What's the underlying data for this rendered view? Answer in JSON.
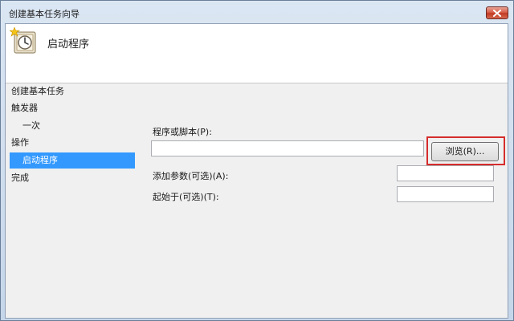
{
  "window": {
    "title": "创建基本任务向导"
  },
  "header": {
    "title": "启动程序",
    "icon": "clock-task-icon"
  },
  "nav": {
    "items": [
      {
        "label": "创建基本任务"
      },
      {
        "label": "触发器"
      },
      {
        "label": "一次"
      },
      {
        "label": "操作"
      },
      {
        "label": "启动程序"
      },
      {
        "label": "完成"
      }
    ],
    "selected": "启动程序"
  },
  "form": {
    "program_label": "程序或脚本(P):",
    "program_value": "",
    "browse_label": "浏览(R)...",
    "args_label": "添加参数(可选)(A):",
    "args_value": "",
    "start_in_label": "起始于(可选)(T):",
    "start_in_value": ""
  },
  "colors": {
    "selection": "#3399ff",
    "highlight_border": "#d62c2c",
    "close_button": "#c23a24"
  }
}
